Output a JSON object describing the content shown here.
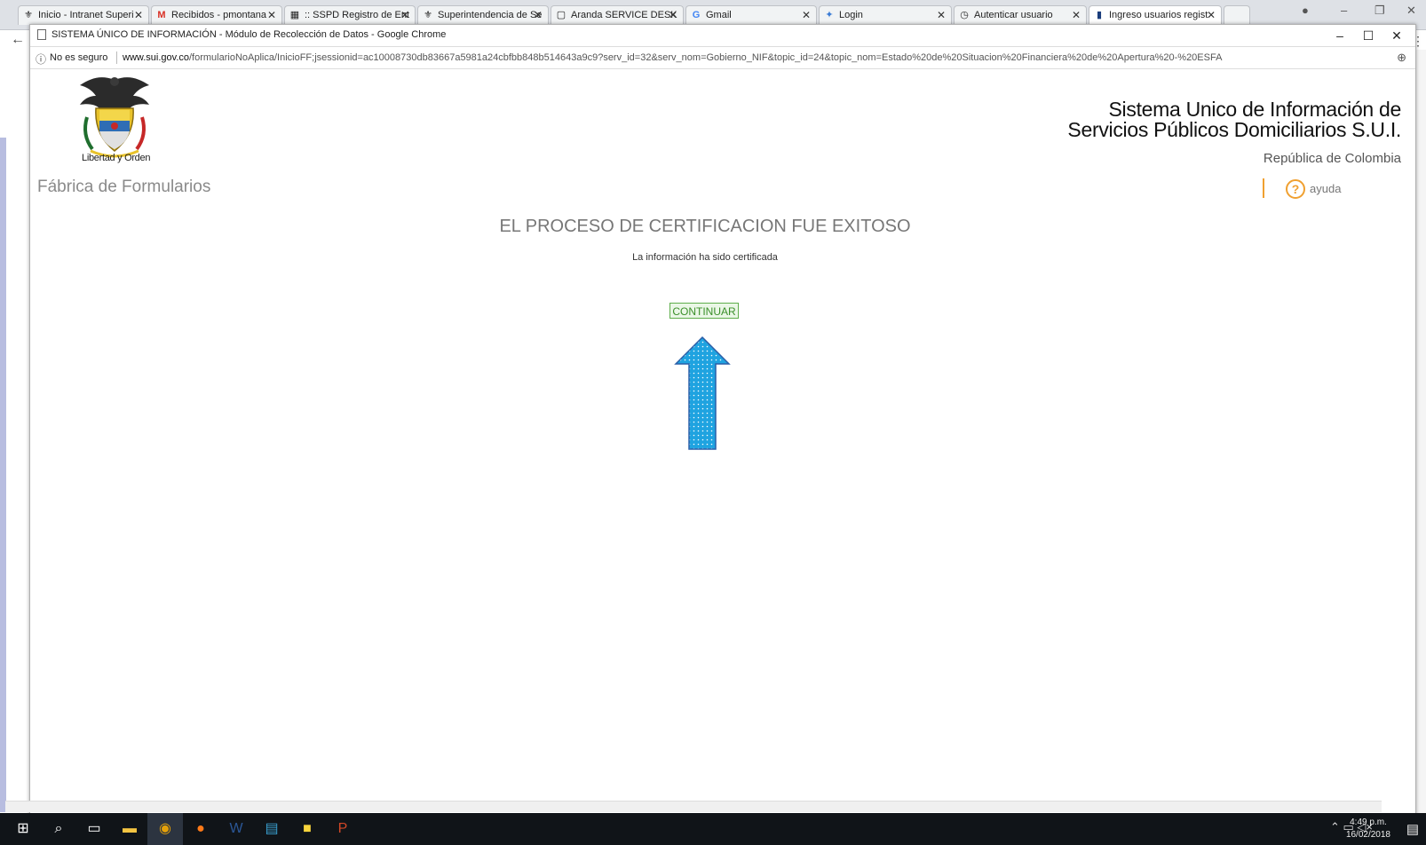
{
  "bg_browser": {
    "tabs": [
      {
        "label": "Inicio - Intranet Superi",
        "icon": "coat-of-arms-icon"
      },
      {
        "label": "Recibidos - pmontana",
        "icon": "gmail-icon"
      },
      {
        "label": ":: SSPD Registro de Ent",
        "icon": "grid-icon"
      },
      {
        "label": "Superintendencia de Se",
        "icon": "coat-of-arms-icon"
      },
      {
        "label": "Aranda SERVICE DESK",
        "icon": "page-icon"
      },
      {
        "label": "Gmail",
        "icon": "google-icon"
      },
      {
        "label": "Login",
        "icon": "login-icon"
      },
      {
        "label": "Autenticar usuario",
        "icon": "clock-icon"
      },
      {
        "label": "Ingreso usuarios regist",
        "icon": "page-icon"
      }
    ]
  },
  "popup": {
    "title": "SISTEMA ÚNICO DE INFORMACIÓN - Módulo de Recolección de Datos - Google Chrome",
    "security_label": "No es seguro",
    "url_host": "www.sui.gov.co",
    "url_path": "/formularioNoAplica/InicioFF;jsessionid=ac10008730db83667a5981a24cbfbb848b514643a9c9?serv_id=32&serv_nom=Gobierno_NIF&topic_id=24&topic_nom=Estado%20de%20Situacion%20Financiera%20de%20Apertura%20-%20ESFA"
  },
  "page": {
    "logo_caption": "Libertad y Orden",
    "factory_title": "Fábrica de Formularios",
    "header_line1": "Sistema Unico de Información de",
    "header_line2": "Servicios Públicos Domiciliarios S.U.I.",
    "header_country": "República de Colombia",
    "help_label": "ayuda",
    "main_title": "EL PROCESO DE CERTIFICACION FUE EXITOSO",
    "main_subtitle": "La información ha sido certificada",
    "continue_label": "CONTINUAR"
  },
  "taskbar": {
    "time": "4:49 p.m.",
    "date": "16/02/2018"
  }
}
